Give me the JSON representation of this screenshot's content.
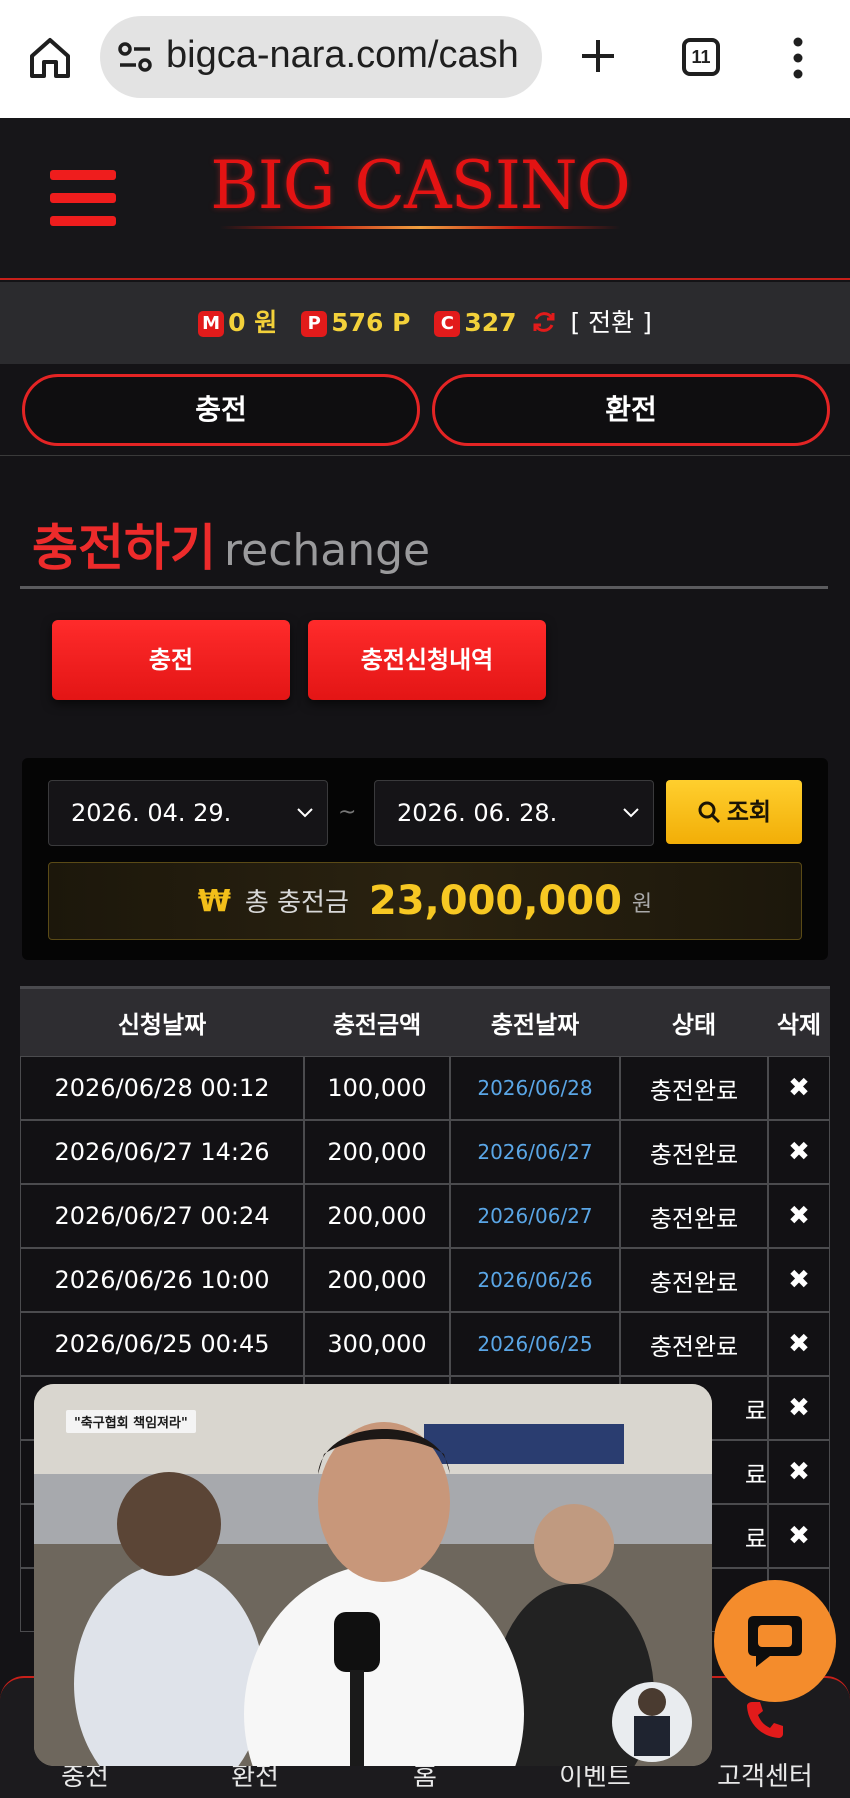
{
  "browser": {
    "url": "bigca-nara.com/cash",
    "tab_count": "11"
  },
  "header": {
    "logo_text": "BIG CASINO"
  },
  "points": {
    "money_badge": "M",
    "money": "0 원",
    "point_badge": "P",
    "point": "576 P",
    "casino_badge": "C",
    "casino": "327",
    "swap_label": "[ 전환 ]"
  },
  "toggles": {
    "charge": "충전",
    "exchange": "환전"
  },
  "section": {
    "title_kr": "충전하기",
    "title_en": "rechange"
  },
  "actions": {
    "charge": "충전",
    "history": "충전신청내역"
  },
  "filter": {
    "date_from": "2026. 04. 29.",
    "separator": "~",
    "date_to": "2026. 06. 28.",
    "search_label": "조회"
  },
  "total": {
    "currency_symbol": "₩",
    "label": "총 충전금",
    "amount": "23,000,000",
    "unit": "원"
  },
  "table": {
    "headers": [
      "신청날짜",
      "충전금액",
      "충전날짜",
      "상태",
      "삭제"
    ],
    "rows": [
      {
        "request_date": "2026/06/28 00:12",
        "amount": "100,000",
        "charge_date": "2026/06/28",
        "status": "충전완료",
        "delete": "✖"
      },
      {
        "request_date": "2026/06/27 14:26",
        "amount": "200,000",
        "charge_date": "2026/06/27",
        "status": "충전완료",
        "delete": "✖"
      },
      {
        "request_date": "2026/06/27 00:24",
        "amount": "200,000",
        "charge_date": "2026/06/27",
        "status": "충전완료",
        "delete": "✖"
      },
      {
        "request_date": "2026/06/26 10:00",
        "amount": "200,000",
        "charge_date": "2026/06/26",
        "status": "충전완료",
        "delete": "✖"
      },
      {
        "request_date": "2026/06/25 00:45",
        "amount": "300,000",
        "charge_date": "2026/06/25",
        "status": "충전완료",
        "delete": "✖"
      },
      {
        "request_date": "",
        "amount": "",
        "charge_date": "",
        "status": "료",
        "delete": "✖"
      },
      {
        "request_date": "",
        "amount": "",
        "charge_date": "",
        "status": "료",
        "delete": "✖"
      },
      {
        "request_date": "",
        "amount": "",
        "charge_date": "",
        "status": "료",
        "delete": "✖"
      },
      {
        "request_date": "",
        "amount": "",
        "charge_date": "",
        "status": "",
        "delete": ""
      }
    ]
  },
  "video": {
    "caption": "\"축구협회 책임져라\""
  },
  "bottom_nav": {
    "items": [
      "충전",
      "환전",
      "홈",
      "이벤트",
      "고객센터"
    ]
  },
  "colors": {
    "accent_red": "#e42424",
    "gold": "#f7c823",
    "link_blue": "#5aa6e6",
    "chat_orange": "#f48c2c"
  }
}
